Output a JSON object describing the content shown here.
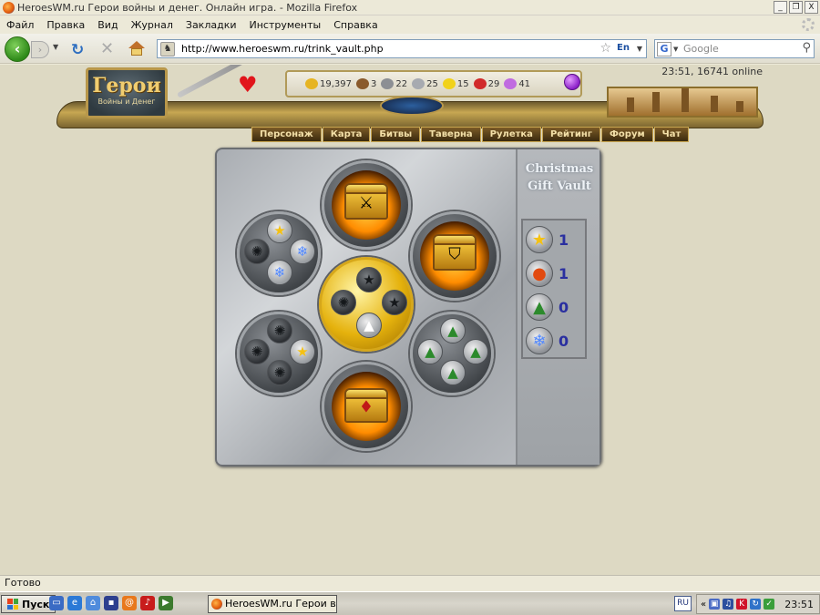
{
  "window": {
    "title": "HeroesWM.ru Герои войны и денег. Онлайн игра. - Mozilla Firefox",
    "buttons": [
      "_",
      "❐",
      "X"
    ]
  },
  "menu": [
    "Файл",
    "Правка",
    "Вид",
    "Журнал",
    "Закладки",
    "Инструменты",
    "Справка"
  ],
  "nav": {
    "url": "http://www.heroeswm.ru/trink_vault.php",
    "lang_indicator": "En",
    "search_placeholder": "Google"
  },
  "page": {
    "online": "23:51, 16741 online",
    "logo": {
      "title": "Герои",
      "subtitle": "Войны и Денег"
    },
    "resources": [
      {
        "name": "gold",
        "value": "19,397",
        "color": "#e6b422"
      },
      {
        "name": "wood",
        "value": "3",
        "color": "#8a5a2b"
      },
      {
        "name": "ore",
        "value": "22",
        "color": "#8c8f94"
      },
      {
        "name": "mercury",
        "value": "25",
        "color": "#a7aab0"
      },
      {
        "name": "sulfur",
        "value": "15",
        "color": "#f1d21a"
      },
      {
        "name": "crystals",
        "value": "29",
        "color": "#d12a2a"
      },
      {
        "name": "gems",
        "value": "41",
        "color": "#c06be0"
      }
    ],
    "navlinks": [
      "Персонаж",
      "Карта",
      "Битвы",
      "Таверна",
      "Рулетка",
      "Рейтинг",
      "Форум",
      "Чат"
    ],
    "vault": {
      "title_line1": "Christmas",
      "title_line2": "Gift Vault",
      "counters": [
        {
          "icon": "star-icon",
          "glyph": "★",
          "value": "1"
        },
        {
          "icon": "ornament-icon",
          "glyph": "●",
          "value": "1"
        },
        {
          "icon": "tree-icon",
          "glyph": "▲",
          "value": "0"
        },
        {
          "icon": "snowflake-icon",
          "glyph": "❄",
          "value": "0"
        }
      ]
    }
  },
  "statusbar": {
    "text": "Готово"
  },
  "taskbar": {
    "start": "Пуск",
    "task": "HeroesWM.ru Герои вой...",
    "lang": "RU",
    "clock": "23:51"
  }
}
